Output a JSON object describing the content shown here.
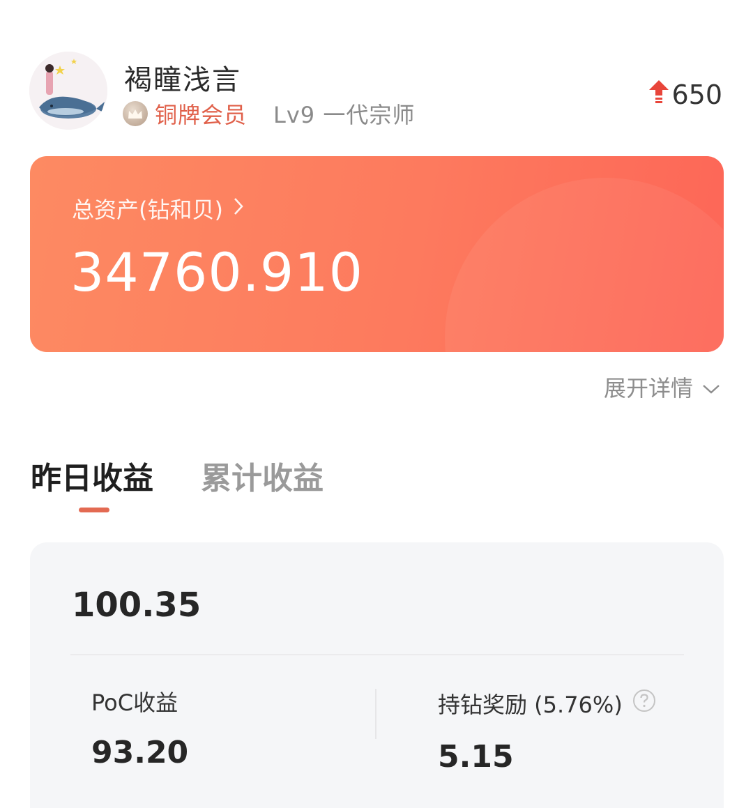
{
  "profile": {
    "username": "褐瞳浅言",
    "member_tier": "铜牌会员",
    "level": "Lv9 一代宗师",
    "score": "650"
  },
  "asset": {
    "title": "总资产(钻和贝)",
    "value": "34760.910"
  },
  "expand_label": "展开详情",
  "tabs": [
    {
      "label": "昨日收益",
      "active": true
    },
    {
      "label": "累计收益",
      "active": false
    }
  ],
  "earnings": {
    "total": "100.35",
    "poc_label": "PoC收益",
    "poc_value": "93.20",
    "hold_label": "持钻奖励 (5.76%)",
    "hold_value": "5.15"
  },
  "colors": {
    "accent": "#e36a52",
    "card_start": "#fd8a62",
    "card_end": "#fd6657",
    "member_text": "#e0604a",
    "score_up": "#e8453a"
  },
  "icons": {
    "avatar": "whale-avatar",
    "crown": "crown-icon",
    "score": "arrow-up-icon",
    "asset_link": "chevron-right-icon",
    "expand": "chevron-down-icon",
    "help": "question-circle-icon"
  }
}
